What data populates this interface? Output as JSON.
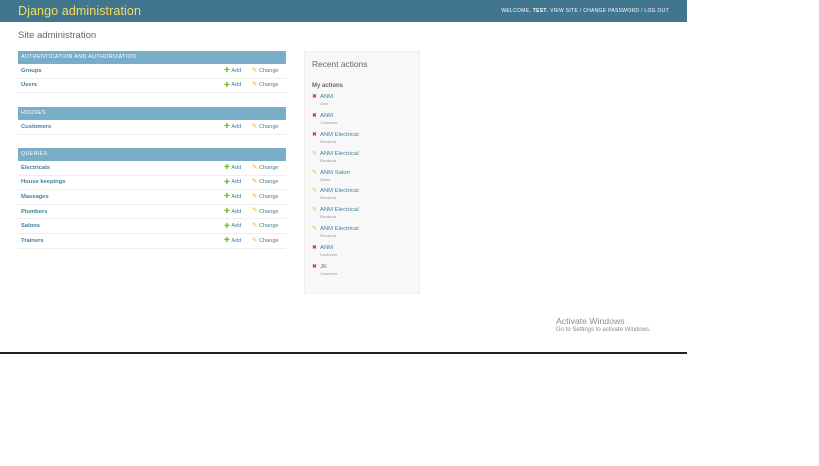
{
  "header": {
    "branding": "Django administration",
    "welcome": "WELCOME,",
    "username": "TEST",
    "view_site": "VIEW SITE",
    "change_password": "CHANGE PASSWORD",
    "log_out": "LOG OUT",
    "separator": "/"
  },
  "page_title": "Site administration",
  "links": {
    "add": "Add",
    "change": "Change"
  },
  "modules": [
    {
      "caption": "Authentication and Authorization",
      "models": [
        "Groups",
        "Users"
      ]
    },
    {
      "caption": "Houses",
      "models": [
        "Customers"
      ]
    },
    {
      "caption": "Queries",
      "models": [
        "Electricals",
        "House keepings",
        "Massages",
        "Plumbers",
        "Salons",
        "Trainers"
      ]
    }
  ],
  "recent": {
    "title": "Recent actions",
    "my_actions": "My actions",
    "items": [
      {
        "name": "ANM",
        "type": "User",
        "action": "delete"
      },
      {
        "name": "ANM",
        "type": "Customer",
        "action": "delete"
      },
      {
        "name": "ANM Electrical",
        "type": "Electrical",
        "action": "delete"
      },
      {
        "name": "ANM Electrical",
        "type": "Electrical",
        "action": "change"
      },
      {
        "name": "ANM Salon",
        "type": "Salon",
        "action": "change"
      },
      {
        "name": "ANM Electrical",
        "type": "Electrical",
        "action": "change"
      },
      {
        "name": "ANM Electrical",
        "type": "Electrical",
        "action": "change"
      },
      {
        "name": "ANM Electrical",
        "type": "Electrical",
        "action": "change"
      },
      {
        "name": "ANM",
        "type": "Customer",
        "action": "delete"
      },
      {
        "name": "JK",
        "type": "Customer",
        "action": "delete"
      }
    ]
  },
  "watermark": {
    "title": "Activate Windows",
    "subtitle": "Go to Settings to activate Windows."
  },
  "icons": {
    "add": "plus-icon",
    "change": "pencil-icon",
    "delete": "x-icon"
  },
  "colors": {
    "header_bg": "#417690",
    "branding": "#f5dd5d",
    "caption_bg": "#79aec8",
    "link": "#447e9b",
    "add_icon": "#70bf2b",
    "change_icon": "#efb80b",
    "delete_icon": "#d42c2c"
  }
}
